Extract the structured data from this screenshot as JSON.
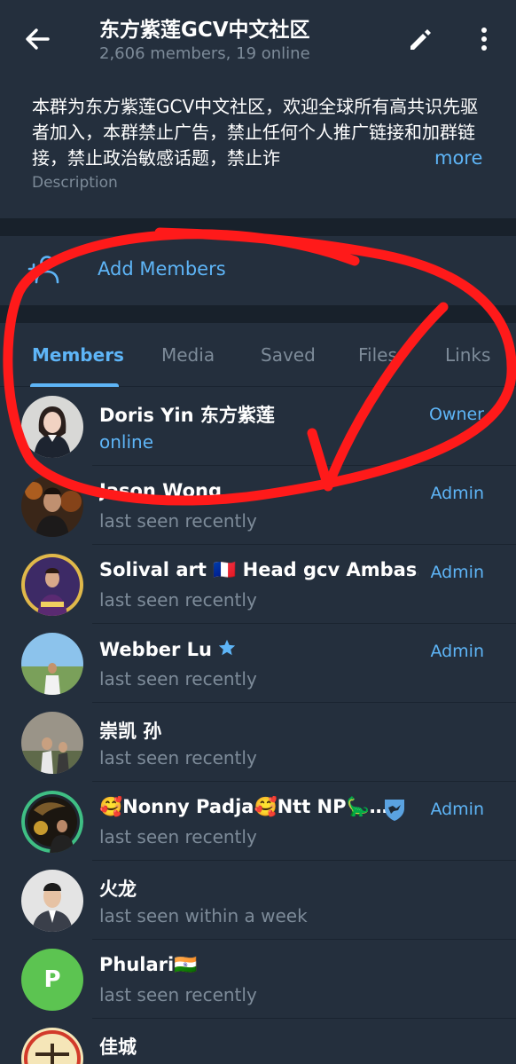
{
  "header": {
    "title": "东方紫莲GCV中文社区",
    "subtitle": "2,606 members, 19 online"
  },
  "description": {
    "text": "本群为东方紫莲GCV中文社区，欢迎全球所有高共识先驱者加入，本群禁止广告，禁止任何个人推广链接和加群链接，禁止政治敏感话题，禁止诈",
    "more": "more",
    "label": "Description"
  },
  "add_members": {
    "label": "Add Members"
  },
  "tabs": [
    {
      "label": "Members"
    },
    {
      "label": "Media"
    },
    {
      "label": "Saved"
    },
    {
      "label": "Files"
    },
    {
      "label": "Links"
    }
  ],
  "members": [
    {
      "name": "Doris Yin 东方紫莲",
      "status": "online",
      "role": "Owner"
    },
    {
      "name": "Jason Wong",
      "status": "last seen recently",
      "role": "Admin"
    },
    {
      "name": "Solival art 🇫🇷 Head gcv Ambas…",
      "status": "last seen recently",
      "role": "Admin"
    },
    {
      "name": "Webber Lu",
      "status": "last seen recently",
      "role": "Admin"
    },
    {
      "name": "崇凯 孙",
      "status": "last seen recently",
      "role": ""
    },
    {
      "name": "🥰Nonny Padja🥰Ntt NP🦕…",
      "status": "last seen recently",
      "role": "Admin"
    },
    {
      "name": "火龙",
      "status": "last seen within a week",
      "role": ""
    },
    {
      "name": "Phulari🇮🇳",
      "status": "last seen recently",
      "role": "",
      "avatar_letter": "P"
    },
    {
      "name": "佳城",
      "status": "",
      "role": ""
    }
  ],
  "colors": {
    "accent": "#5eb5f7",
    "background": "#242f3d",
    "secondary_text": "#7d8b99",
    "annotation_red": "#ff1a1a",
    "avatar_green": "#5cc451"
  }
}
